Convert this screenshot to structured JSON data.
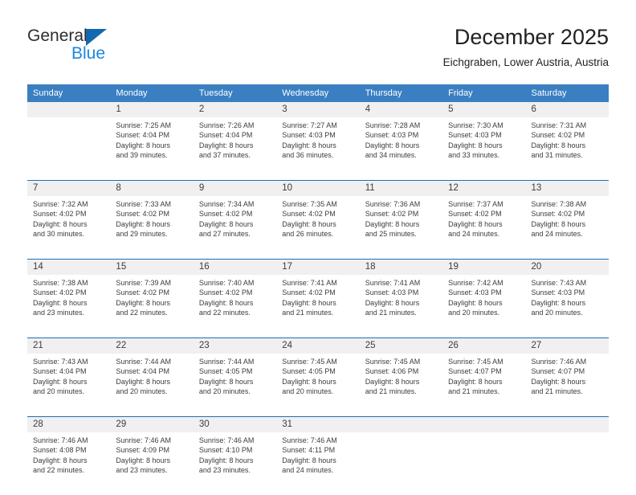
{
  "brand": {
    "name_part1": "General",
    "name_part2": "Blue",
    "triangle_color": "#1269b0",
    "blue_color": "#1b87dd"
  },
  "header": {
    "title": "December 2025",
    "location": "Eichgraben, Lower Austria, Austria"
  },
  "theme": {
    "header_band": "#3a7fc1",
    "week_divider": "#1f6eb5",
    "daynum_band": "#f0f0f0",
    "text": "#3c3c3c"
  },
  "weekdays": [
    "Sunday",
    "Monday",
    "Tuesday",
    "Wednesday",
    "Thursday",
    "Friday",
    "Saturday"
  ],
  "labels": {
    "sunrise_prefix": "Sunrise:",
    "sunset_prefix": "Sunset:",
    "daylight_prefix": "Daylight:"
  },
  "weeks": [
    {
      "days": [
        {
          "num": "",
          "line1": "",
          "line2": "",
          "line3": "",
          "line4": ""
        },
        {
          "num": "1",
          "line1": "Sunrise: 7:25 AM",
          "line2": "Sunset: 4:04 PM",
          "line3": "Daylight: 8 hours",
          "line4": "and 39 minutes."
        },
        {
          "num": "2",
          "line1": "Sunrise: 7:26 AM",
          "line2": "Sunset: 4:04 PM",
          "line3": "Daylight: 8 hours",
          "line4": "and 37 minutes."
        },
        {
          "num": "3",
          "line1": "Sunrise: 7:27 AM",
          "line2": "Sunset: 4:03 PM",
          "line3": "Daylight: 8 hours",
          "line4": "and 36 minutes."
        },
        {
          "num": "4",
          "line1": "Sunrise: 7:28 AM",
          "line2": "Sunset: 4:03 PM",
          "line3": "Daylight: 8 hours",
          "line4": "and 34 minutes."
        },
        {
          "num": "5",
          "line1": "Sunrise: 7:30 AM",
          "line2": "Sunset: 4:03 PM",
          "line3": "Daylight: 8 hours",
          "line4": "and 33 minutes."
        },
        {
          "num": "6",
          "line1": "Sunrise: 7:31 AM",
          "line2": "Sunset: 4:02 PM",
          "line3": "Daylight: 8 hours",
          "line4": "and 31 minutes."
        }
      ]
    },
    {
      "days": [
        {
          "num": "7",
          "line1": "Sunrise: 7:32 AM",
          "line2": "Sunset: 4:02 PM",
          "line3": "Daylight: 8 hours",
          "line4": "and 30 minutes."
        },
        {
          "num": "8",
          "line1": "Sunrise: 7:33 AM",
          "line2": "Sunset: 4:02 PM",
          "line3": "Daylight: 8 hours",
          "line4": "and 29 minutes."
        },
        {
          "num": "9",
          "line1": "Sunrise: 7:34 AM",
          "line2": "Sunset: 4:02 PM",
          "line3": "Daylight: 8 hours",
          "line4": "and 27 minutes."
        },
        {
          "num": "10",
          "line1": "Sunrise: 7:35 AM",
          "line2": "Sunset: 4:02 PM",
          "line3": "Daylight: 8 hours",
          "line4": "and 26 minutes."
        },
        {
          "num": "11",
          "line1": "Sunrise: 7:36 AM",
          "line2": "Sunset: 4:02 PM",
          "line3": "Daylight: 8 hours",
          "line4": "and 25 minutes."
        },
        {
          "num": "12",
          "line1": "Sunrise: 7:37 AM",
          "line2": "Sunset: 4:02 PM",
          "line3": "Daylight: 8 hours",
          "line4": "and 24 minutes."
        },
        {
          "num": "13",
          "line1": "Sunrise: 7:38 AM",
          "line2": "Sunset: 4:02 PM",
          "line3": "Daylight: 8 hours",
          "line4": "and 24 minutes."
        }
      ]
    },
    {
      "days": [
        {
          "num": "14",
          "line1": "Sunrise: 7:38 AM",
          "line2": "Sunset: 4:02 PM",
          "line3": "Daylight: 8 hours",
          "line4": "and 23 minutes."
        },
        {
          "num": "15",
          "line1": "Sunrise: 7:39 AM",
          "line2": "Sunset: 4:02 PM",
          "line3": "Daylight: 8 hours",
          "line4": "and 22 minutes."
        },
        {
          "num": "16",
          "line1": "Sunrise: 7:40 AM",
          "line2": "Sunset: 4:02 PM",
          "line3": "Daylight: 8 hours",
          "line4": "and 22 minutes."
        },
        {
          "num": "17",
          "line1": "Sunrise: 7:41 AM",
          "line2": "Sunset: 4:02 PM",
          "line3": "Daylight: 8 hours",
          "line4": "and 21 minutes."
        },
        {
          "num": "18",
          "line1": "Sunrise: 7:41 AM",
          "line2": "Sunset: 4:03 PM",
          "line3": "Daylight: 8 hours",
          "line4": "and 21 minutes."
        },
        {
          "num": "19",
          "line1": "Sunrise: 7:42 AM",
          "line2": "Sunset: 4:03 PM",
          "line3": "Daylight: 8 hours",
          "line4": "and 20 minutes."
        },
        {
          "num": "20",
          "line1": "Sunrise: 7:43 AM",
          "line2": "Sunset: 4:03 PM",
          "line3": "Daylight: 8 hours",
          "line4": "and 20 minutes."
        }
      ]
    },
    {
      "days": [
        {
          "num": "21",
          "line1": "Sunrise: 7:43 AM",
          "line2": "Sunset: 4:04 PM",
          "line3": "Daylight: 8 hours",
          "line4": "and 20 minutes."
        },
        {
          "num": "22",
          "line1": "Sunrise: 7:44 AM",
          "line2": "Sunset: 4:04 PM",
          "line3": "Daylight: 8 hours",
          "line4": "and 20 minutes."
        },
        {
          "num": "23",
          "line1": "Sunrise: 7:44 AM",
          "line2": "Sunset: 4:05 PM",
          "line3": "Daylight: 8 hours",
          "line4": "and 20 minutes."
        },
        {
          "num": "24",
          "line1": "Sunrise: 7:45 AM",
          "line2": "Sunset: 4:05 PM",
          "line3": "Daylight: 8 hours",
          "line4": "and 20 minutes."
        },
        {
          "num": "25",
          "line1": "Sunrise: 7:45 AM",
          "line2": "Sunset: 4:06 PM",
          "line3": "Daylight: 8 hours",
          "line4": "and 21 minutes."
        },
        {
          "num": "26",
          "line1": "Sunrise: 7:45 AM",
          "line2": "Sunset: 4:07 PM",
          "line3": "Daylight: 8 hours",
          "line4": "and 21 minutes."
        },
        {
          "num": "27",
          "line1": "Sunrise: 7:46 AM",
          "line2": "Sunset: 4:07 PM",
          "line3": "Daylight: 8 hours",
          "line4": "and 21 minutes."
        }
      ]
    },
    {
      "days": [
        {
          "num": "28",
          "line1": "Sunrise: 7:46 AM",
          "line2": "Sunset: 4:08 PM",
          "line3": "Daylight: 8 hours",
          "line4": "and 22 minutes."
        },
        {
          "num": "29",
          "line1": "Sunrise: 7:46 AM",
          "line2": "Sunset: 4:09 PM",
          "line3": "Daylight: 8 hours",
          "line4": "and 23 minutes."
        },
        {
          "num": "30",
          "line1": "Sunrise: 7:46 AM",
          "line2": "Sunset: 4:10 PM",
          "line3": "Daylight: 8 hours",
          "line4": "and 23 minutes."
        },
        {
          "num": "31",
          "line1": "Sunrise: 7:46 AM",
          "line2": "Sunset: 4:11 PM",
          "line3": "Daylight: 8 hours",
          "line4": "and 24 minutes."
        },
        {
          "num": "",
          "line1": "",
          "line2": "",
          "line3": "",
          "line4": ""
        },
        {
          "num": "",
          "line1": "",
          "line2": "",
          "line3": "",
          "line4": ""
        },
        {
          "num": "",
          "line1": "",
          "line2": "",
          "line3": "",
          "line4": ""
        }
      ]
    }
  ]
}
